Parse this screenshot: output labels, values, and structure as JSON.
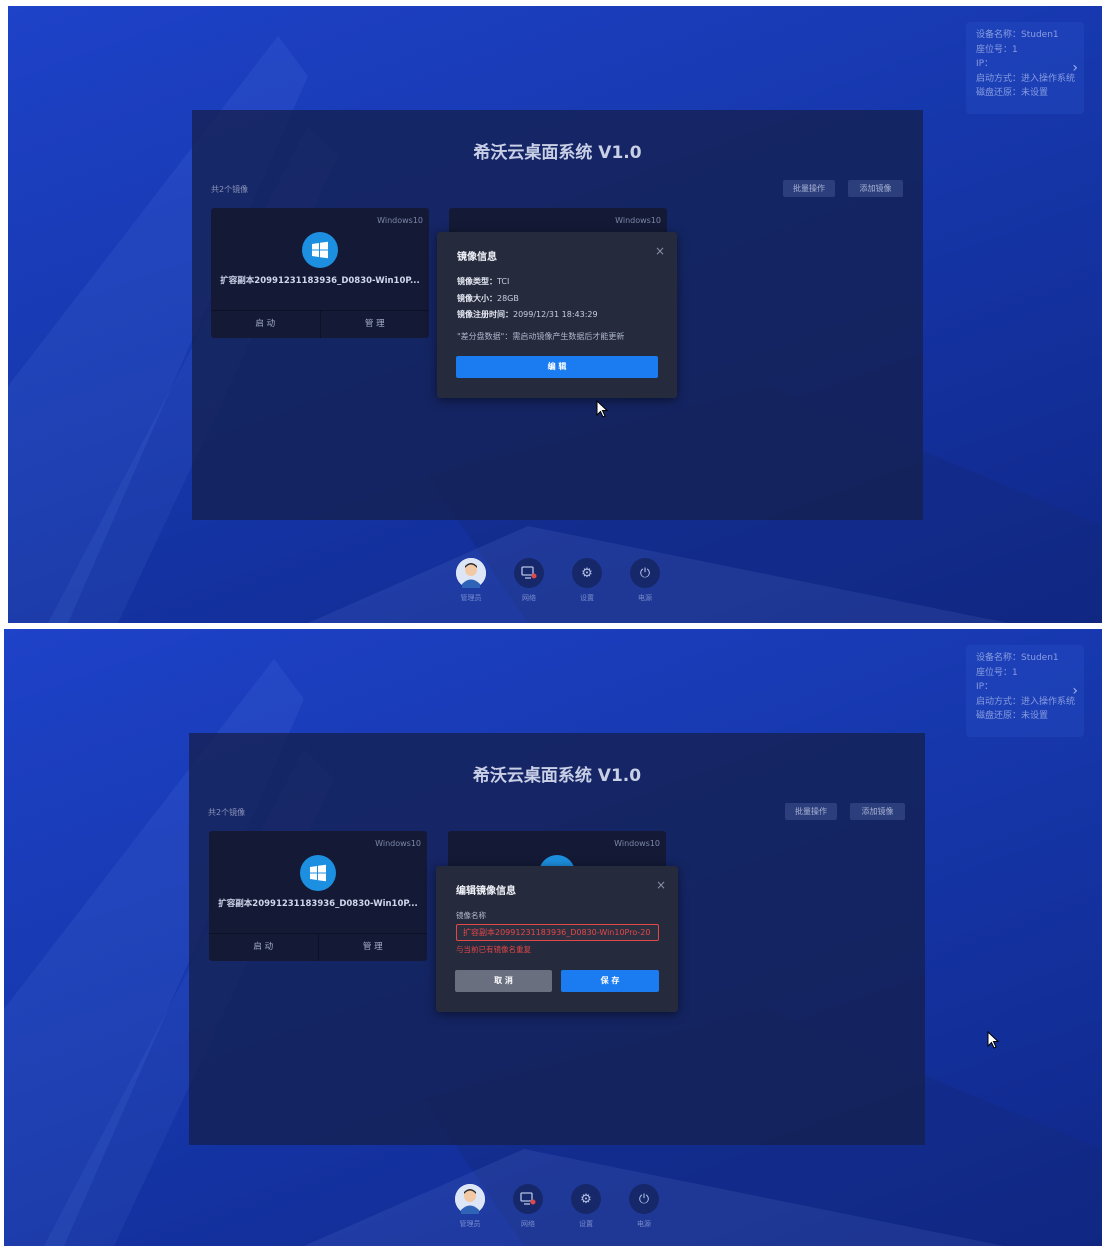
{
  "system_info": {
    "lines": [
      "设备名称：Studen1",
      "座位号：1",
      "IP：",
      "启动方式：进入操作系统",
      "磁盘还原：未设置"
    ]
  },
  "title": "希沃云桌面系统 V1.0",
  "image_count": "共2个镜像",
  "toolbar": {
    "batch_label": "批量操作",
    "add_label": "添加镜像"
  },
  "cards": [
    {
      "os": "Windows10",
      "name": "扩容副本20991231183936_D0830-Win10P...",
      "start_label": "启 动",
      "manage_label": "管 理"
    },
    {
      "os": "Windows10"
    }
  ],
  "info_modal": {
    "title": "镜像信息",
    "close": "×",
    "type_label": "镜像类型：",
    "type_value": "TCI",
    "size_label": "镜像大小：",
    "size_value": "28GB",
    "time_label": "镜像注册时间：",
    "time_value": "2099/12/31 18:43:29",
    "note": "\"差分盘数据\"：需启动镜像产生数据后才能更新",
    "edit_label": "编 辑"
  },
  "edit_modal": {
    "title": "编辑镜像信息",
    "close": "×",
    "field_label": "镜像名称",
    "field_value": "扩容副本20991231183936_D0830-Win10Pro-20",
    "error": "与当前已有镜像名重复",
    "cancel_label": "取 消",
    "save_label": "保 存"
  },
  "dock": [
    {
      "label": "管理员",
      "icon": "admin-avatar-icon"
    },
    {
      "label": "网络",
      "icon": "network-icon"
    },
    {
      "label": "设置",
      "icon": "settings-gear-icon"
    },
    {
      "label": "电源",
      "icon": "power-icon"
    }
  ]
}
